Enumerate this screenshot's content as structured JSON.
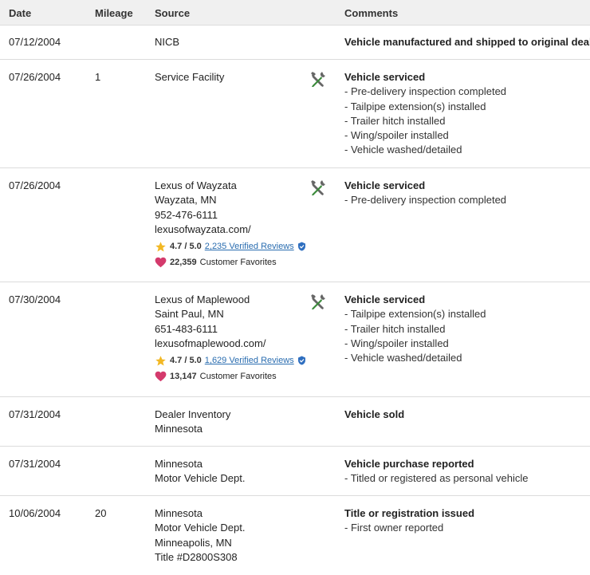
{
  "header": {
    "date": "Date",
    "mileage": "Mileage",
    "source": "Source",
    "comments": "Comments"
  },
  "rows": [
    {
      "date": "07/12/2004",
      "mileage": "",
      "source": [
        "NICB"
      ],
      "icon": "",
      "title": "Vehicle manufactured and shipped to original dealer",
      "items": []
    },
    {
      "date": "07/26/2004",
      "mileage": "1",
      "source": [
        "Service Facility"
      ],
      "icon": "tools-icon",
      "title": "Vehicle serviced",
      "items": [
        "- Pre-delivery inspection completed",
        "- Tailpipe extension(s) installed",
        "- Trailer hitch installed",
        "- Wing/spoiler installed",
        "- Vehicle washed/detailed"
      ]
    },
    {
      "date": "07/26/2004",
      "mileage": "",
      "source": [
        "Lexus of Wayzata",
        "Wayzata, MN",
        "952-476-6111",
        "lexusofwayzata.com/"
      ],
      "rating": "4.7 / 5.0",
      "reviews": "2,235 Verified Reviews",
      "favorites": "22,359",
      "favorites_label": "Customer Favorites",
      "icon": "tools-icon",
      "title": "Vehicle serviced",
      "items": [
        "- Pre-delivery inspection completed"
      ]
    },
    {
      "date": "07/30/2004",
      "mileage": "",
      "source": [
        "Lexus of Maplewood",
        "Saint Paul, MN",
        "651-483-6111",
        "lexusofmaplewood.com/"
      ],
      "rating": "4.7 / 5.0",
      "reviews": "1,629 Verified Reviews",
      "favorites": "13,147",
      "favorites_label": "Customer Favorites",
      "icon": "tools-icon",
      "title": "Vehicle serviced",
      "items": [
        "- Tailpipe extension(s) installed",
        "- Trailer hitch installed",
        "- Wing/spoiler installed",
        "- Vehicle washed/detailed"
      ]
    },
    {
      "date": "07/31/2004",
      "mileage": "",
      "source": [
        "Dealer Inventory",
        "Minnesota"
      ],
      "icon": "",
      "title": "Vehicle sold",
      "items": []
    },
    {
      "date": "07/31/2004",
      "mileage": "",
      "source": [
        "Minnesota",
        "Motor Vehicle Dept."
      ],
      "icon": "",
      "title": "Vehicle purchase reported",
      "items": [
        "- Titled or registered as personal vehicle"
      ]
    },
    {
      "date": "10/06/2004",
      "mileage": "20",
      "source": [
        "Minnesota",
        "Motor Vehicle Dept.",
        "Minneapolis, MN",
        "Title #D2800S308"
      ],
      "icon": "",
      "title": "Title or registration issued",
      "items": [
        "- First owner reported"
      ]
    }
  ],
  "colors": {
    "star": "#f2b824",
    "heart": "#d43a6c",
    "link": "#2a6db0",
    "badge": "#2f6fc0",
    "tool_handle": "#3a8a3a",
    "tool_metal": "#666666"
  }
}
